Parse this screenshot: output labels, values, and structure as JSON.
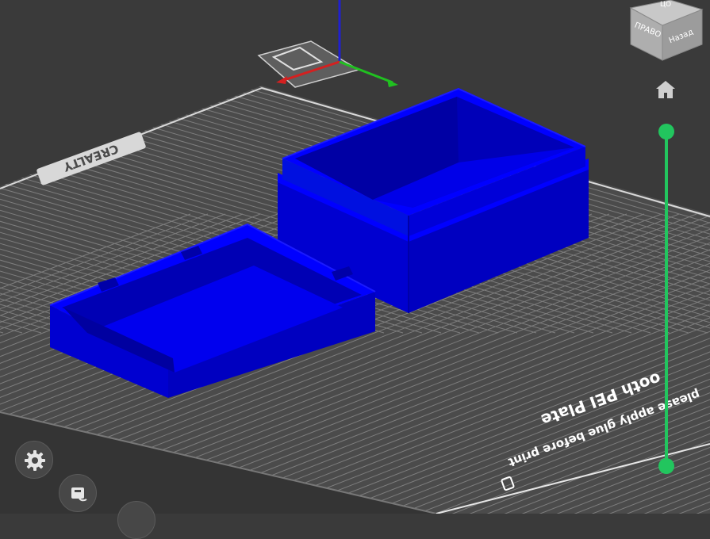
{
  "viewport": {
    "bed_brand": "CREALTY",
    "bed_plate_title": "Smooth PEI Plate",
    "bed_plate_title_visible": "ooth PEI Plate",
    "bed_plate_note": "please apply glue before print"
  },
  "nav_cube": {
    "face_left": "ПРАВО",
    "face_right": "Назад",
    "face_top": "ЦО"
  },
  "home": {
    "icon": "home-icon"
  },
  "settings": {
    "icon": "gear-icon"
  },
  "plate_settings": {
    "icon": "plate-icon"
  },
  "colors": {
    "background": "#3a3a3a",
    "bed": "#4b4b4b",
    "grid": "#8a8a8a",
    "model": "#0000e6",
    "slider": "#22c55e",
    "axis_x": "#d42020",
    "axis_y": "#20c020",
    "axis_z": "#2020d0"
  }
}
